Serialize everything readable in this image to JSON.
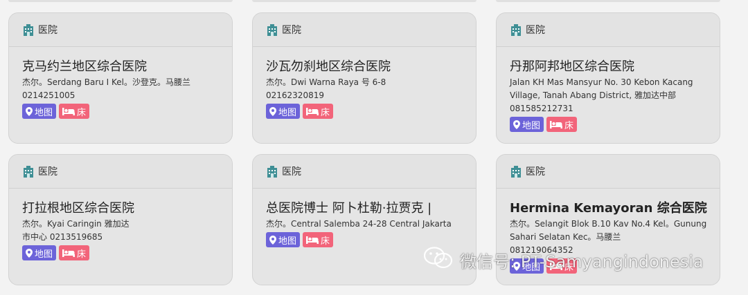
{
  "cards": [
    {
      "category": "医院",
      "title": "克马约兰地区综合医院",
      "address": "杰尔。Serdang Baru I Kel。沙登克。马腰兰",
      "phone": "0214251005",
      "map_label": "地图",
      "bed_label": "床"
    },
    {
      "category": "医院",
      "title": "沙瓦勿刹地区综合医院",
      "address": "杰尔。Dwi Warna Raya 号 6-8",
      "phone": "02162320819",
      "map_label": "地图",
      "bed_label": "床"
    },
    {
      "category": "医院",
      "title": "丹那阿邦地区综合医院",
      "address": "Jalan KH Mas Mansyur No. 30 Kebon Kacang Village, Tanah Abang District, 雅加达中部",
      "phone": "081585212731",
      "map_label": "地图",
      "bed_label": "床"
    },
    {
      "category": "医院",
      "title": "打拉根地区综合医院",
      "address": "杰尔。Kyai Caringin 雅加达市中心",
      "phone": "0213519685",
      "map_label": "地图",
      "bed_label": "床"
    },
    {
      "category": "医院",
      "title": "总医院博士 阿卜杜勒·拉贾克 |",
      "address": "杰尔。Central Salemba 24-28 Central Jakarta",
      "phone": "",
      "map_label": "地图",
      "bed_label": "床"
    },
    {
      "category": "医院",
      "title": "Hermina Kemayoran 综合医院",
      "address": "杰尔。Selangit Blok B.10 Kav No.4 Kel。Gunung Sahari Selatan Kec。马腰兰",
      "phone": "081219064352",
      "map_label": "地图",
      "bed_label": "床"
    }
  ],
  "watermark": {
    "text": "微信号: PT-Samyangindonesia"
  },
  "icons": {
    "category": "hospital-icon",
    "map": "map-pin-icon",
    "bed": "bed-icon",
    "watermark": "wechat-icon"
  },
  "colors": {
    "map_tag": "#6c63d9",
    "bed_tag": "#f2647a",
    "card_bg": "#e5e5e5",
    "page_bg": "#f3f3f3"
  }
}
